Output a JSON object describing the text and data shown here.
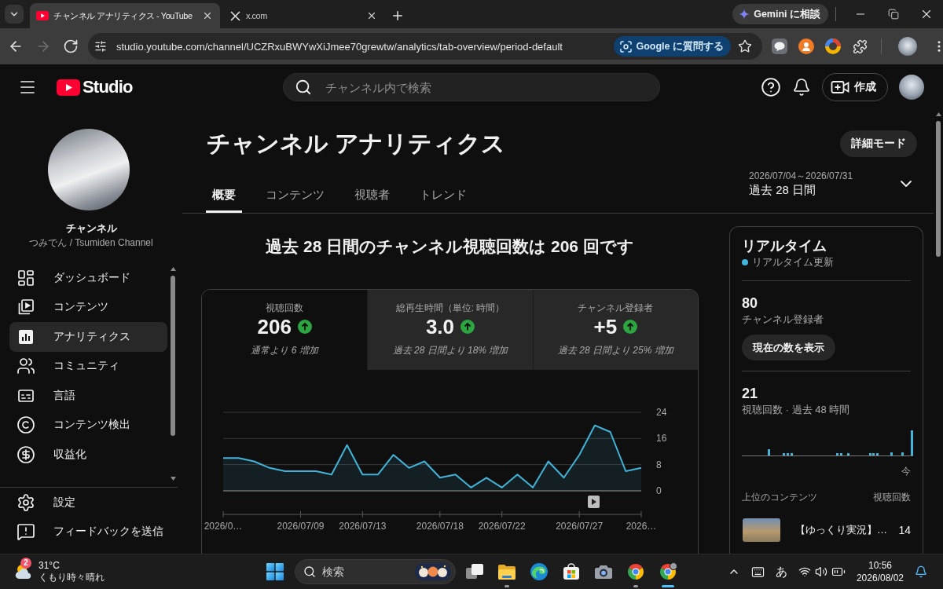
{
  "browser": {
    "tabs": [
      {
        "kind": "youtube",
        "title": "チャンネル アナリティクス - YouTube",
        "selected": true
      },
      {
        "kind": "x",
        "title": "x.com",
        "selected": false
      }
    ],
    "gemini_button": "Gemini に相談",
    "nav": [
      {
        "kind": "back",
        "disabled": false
      },
      {
        "kind": "forward",
        "disabled": true
      },
      {
        "kind": "reload",
        "disabled": false
      }
    ],
    "url": "studio.youtube.com/channel/UCZRxuBWYwXiJmee70grewtw/analytics/tab-overview/period-default",
    "ask_chip": "Google に質問する"
  },
  "header": {
    "logo": "Studio",
    "search": {
      "placeholder": "チャンネル内で検索"
    },
    "create_button": "作成"
  },
  "sidebar": {
    "channel_label": "チャンネル",
    "channel_name": "つみでん / Tsumiden Channel",
    "items": [
      {
        "kind": "dashboard",
        "label": "ダッシュボード",
        "selected": false
      },
      {
        "kind": "content",
        "label": "コンテンツ",
        "selected": false
      },
      {
        "kind": "analytics",
        "label": "アナリティクス",
        "selected": true
      },
      {
        "kind": "community",
        "label": "コミュニティ",
        "selected": false
      },
      {
        "kind": "language",
        "label": "言語",
        "selected": false
      },
      {
        "kind": "copyright",
        "label": "コンテンツ検出",
        "selected": false
      },
      {
        "kind": "monetization",
        "label": "収益化",
        "selected": false
      }
    ],
    "footer_items": [
      {
        "kind": "settings",
        "label": "設定"
      },
      {
        "kind": "feedback",
        "label": "フィードバックを送信"
      }
    ]
  },
  "page": {
    "title": "チャンネル アナリティクス",
    "advanced_button": "詳細モード",
    "tabs": [
      {
        "label": "概要",
        "selected": true
      },
      {
        "label": "コンテンツ",
        "selected": false
      },
      {
        "label": "視聴者",
        "selected": false
      },
      {
        "label": "トレンド",
        "selected": false
      }
    ],
    "period": {
      "range": "2026/07/04～2026/07/31",
      "label": "過去 28 日間"
    },
    "summary": "過去 28 日間のチャンネル視聴回数は 206 回です",
    "metrics": [
      {
        "label": "視聴回数",
        "value": "206",
        "rising": true,
        "note": "通常より 6 増加",
        "selected": true
      },
      {
        "label": "総再生時間（単位: 時間）",
        "value": "3.0",
        "rising": true,
        "note": "過去 28 日間より 18% 増加",
        "selected": false
      },
      {
        "label": "チャンネル登録者",
        "value": "+5",
        "rising": true,
        "note": "過去 28 日間より 25% 増加",
        "selected": false
      }
    ],
    "chart_data": {
      "type": "area",
      "categories": [
        "2026/0…",
        null,
        null,
        null,
        null,
        "2026/07/09",
        null,
        null,
        null,
        "2026/07/13",
        null,
        null,
        null,
        null,
        "2026/07/18",
        null,
        null,
        null,
        "2026/07/22",
        null,
        null,
        null,
        null,
        "2026/07/27",
        null,
        null,
        null,
        "2026…"
      ],
      "series": [
        {
          "color": "#41b4d9",
          "values": [
            10,
            10,
            9,
            7,
            6,
            6,
            6,
            5,
            14,
            5,
            5,
            11,
            7,
            9,
            4,
            5,
            1,
            4,
            1,
            5,
            1,
            9,
            4,
            11,
            20,
            18,
            6,
            7
          ]
        }
      ],
      "ylim": [
        0,
        24
      ],
      "yticks": [
        0,
        8,
        16,
        24
      ]
    }
  },
  "realtime": {
    "title": "リアルタイム",
    "status": "リアルタイム更新",
    "stats": [
      {
        "kind": "subscribers",
        "value": "80",
        "label": "チャンネル登録者",
        "button": "現在の数を表示"
      },
      {
        "kind": "views",
        "value": "21",
        "label": "視聴回数 · 過去 48 時間",
        "axis_label": "今"
      }
    ],
    "top_content": {
      "heading": "上位のコンテンツ",
      "column": "視聴回数",
      "rows": [
        {
          "title": "【ゆっくり実況】…",
          "views": "14"
        }
      ]
    }
  },
  "taskbar": {
    "weather": {
      "badge": "2",
      "temperature": "31°C",
      "condition": "くもり時々晴れ"
    },
    "search": {
      "placeholder": "検索"
    },
    "apps": [
      {
        "kind": "task_view",
        "open": false,
        "selected": false
      },
      {
        "kind": "files",
        "open": true,
        "selected": false
      },
      {
        "kind": "edge",
        "open": false,
        "selected": false
      },
      {
        "kind": "store",
        "open": false,
        "selected": false
      },
      {
        "kind": "camera",
        "open": false,
        "selected": false
      },
      {
        "kind": "chrome",
        "open": true,
        "selected": false
      },
      {
        "kind": "chrome_profile",
        "open": true,
        "selected": true
      }
    ],
    "tray": {
      "ime": "あ"
    },
    "clock": {
      "time": "10:56",
      "date": "2026/08/02"
    }
  }
}
